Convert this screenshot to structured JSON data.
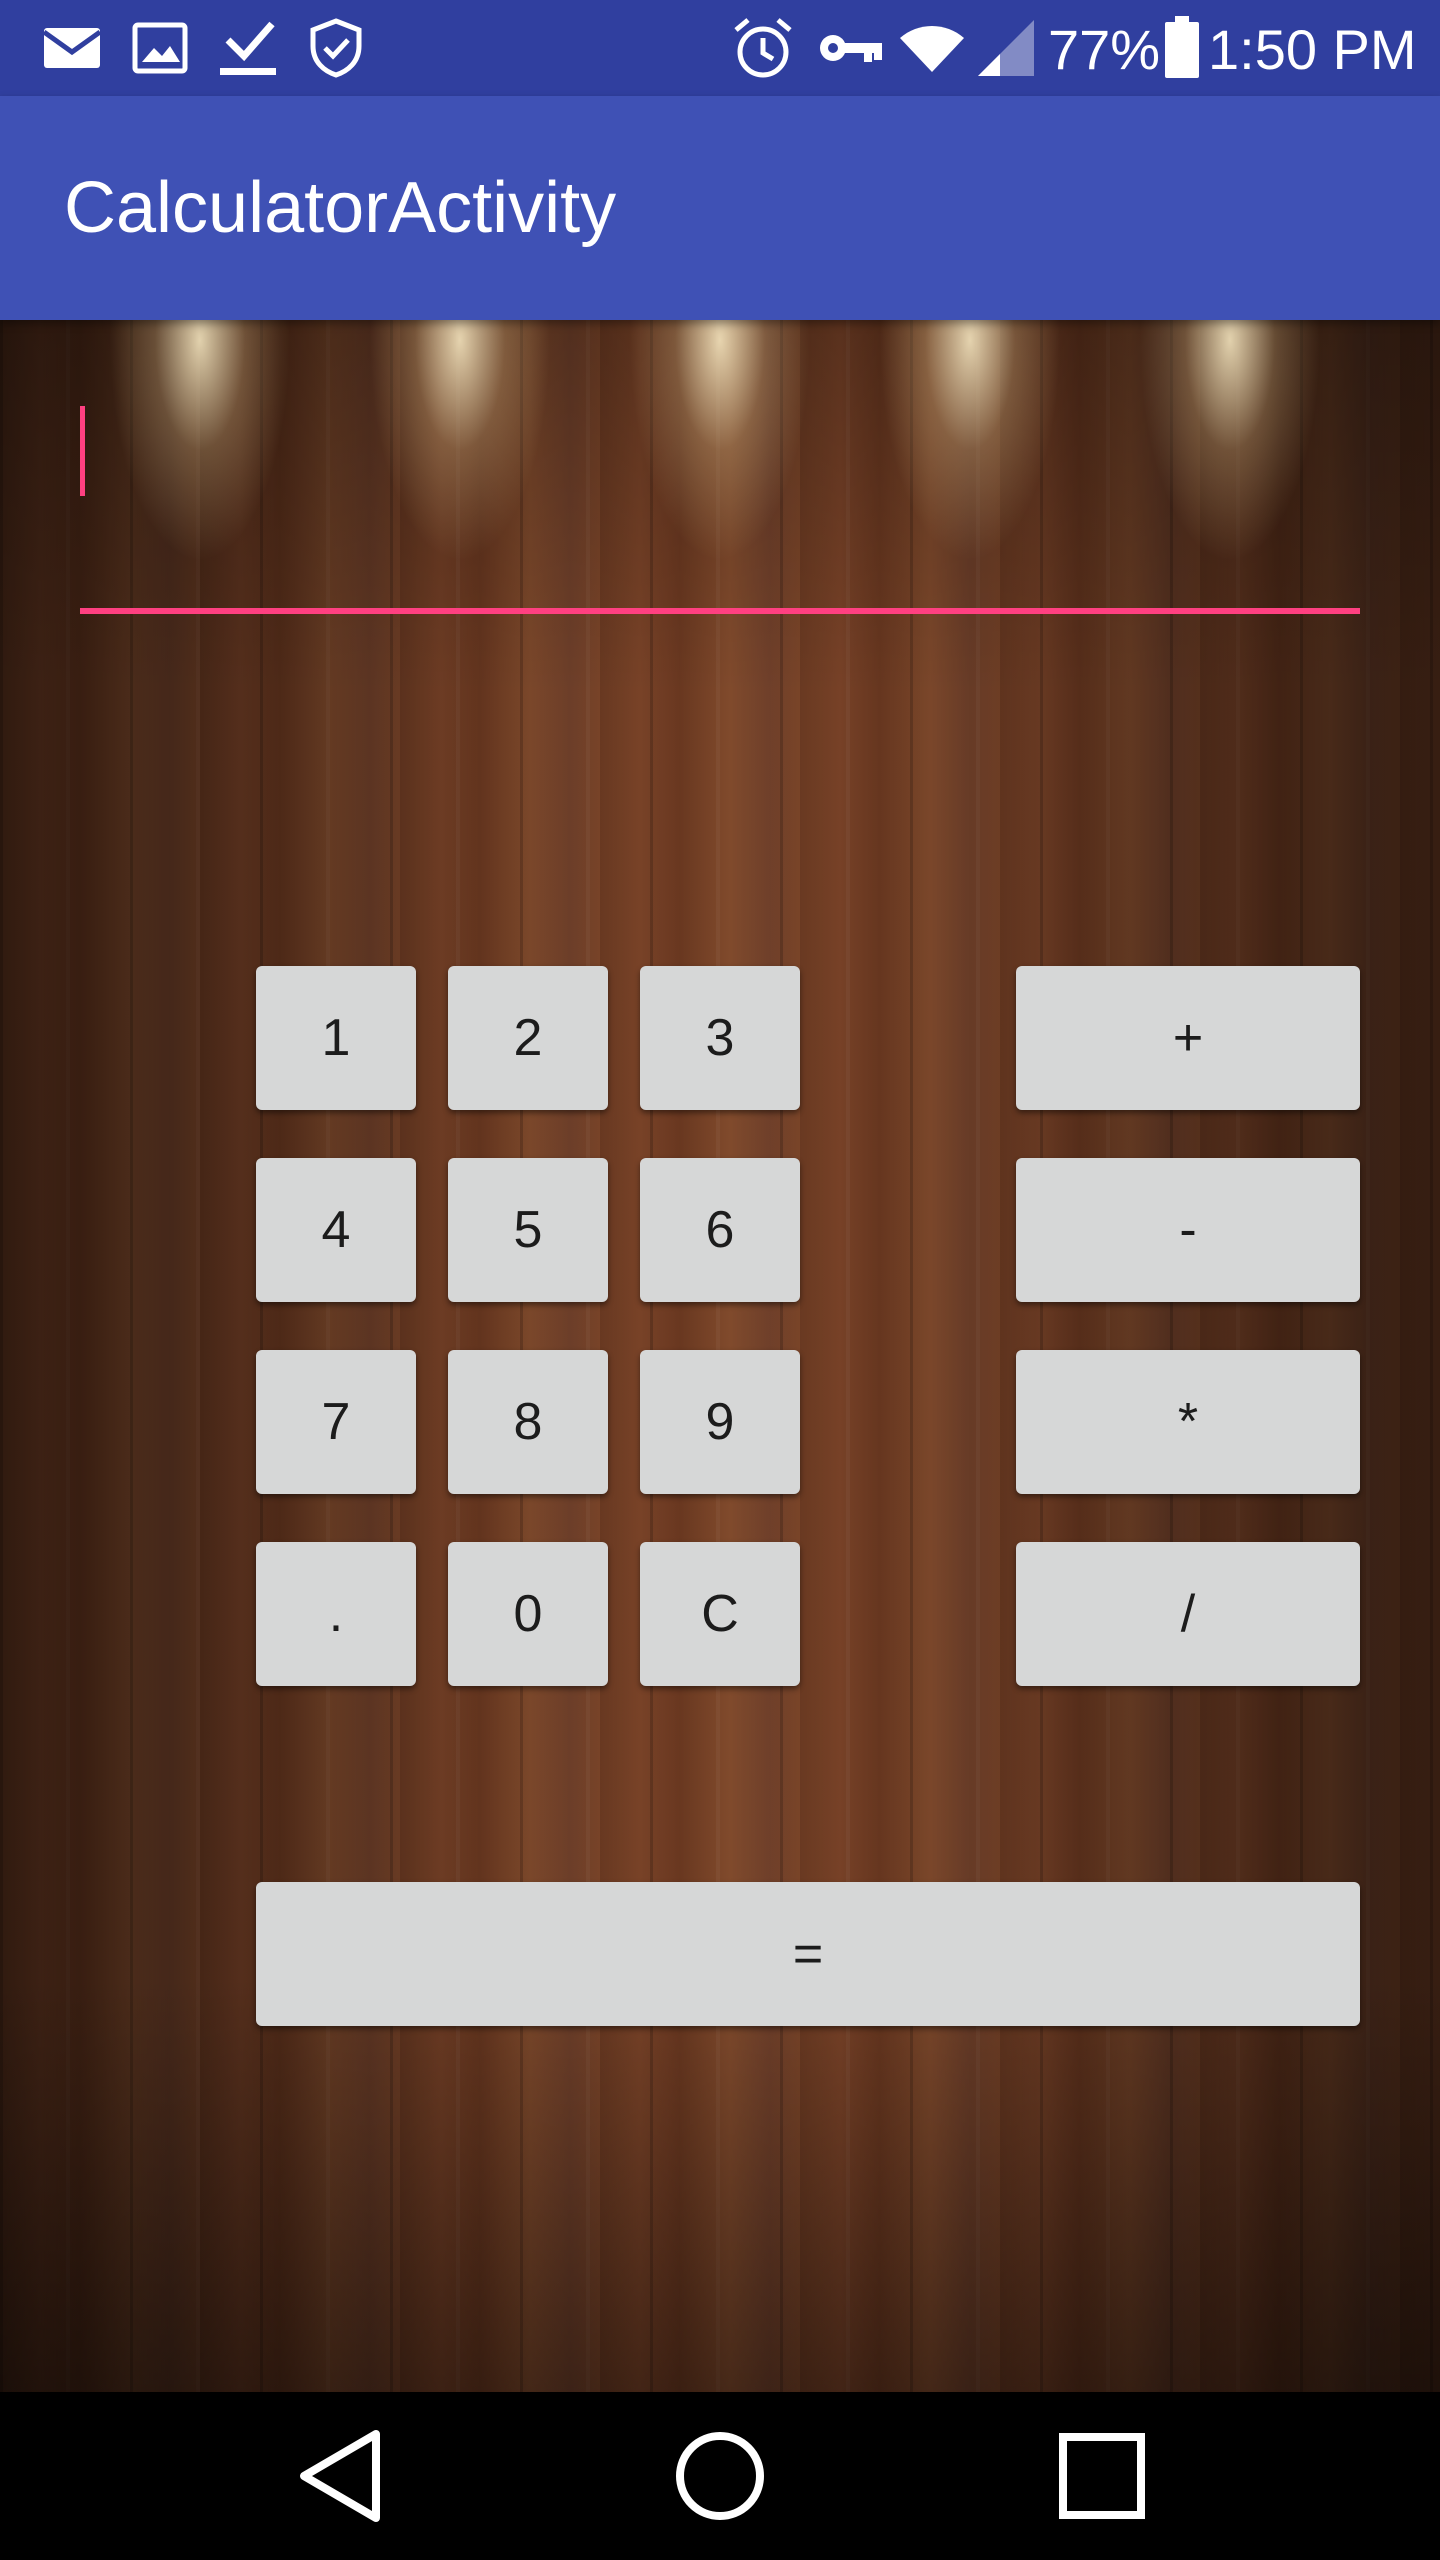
{
  "status_bar": {
    "notification_icons": [
      "mail-icon",
      "image-icon",
      "download-done-icon",
      "shield-check-icon"
    ],
    "system_icons": [
      "alarm-icon",
      "vpn-key-icon",
      "wifi-icon",
      "signal-icon",
      "battery-icon"
    ],
    "battery_percent": "77%",
    "time": "1:50 PM"
  },
  "app_bar": {
    "title": "CalculatorActivity",
    "color": "#3f51b5"
  },
  "display": {
    "value": "",
    "placeholder": "",
    "accent_color": "#ff4081"
  },
  "keypad": {
    "digits": {
      "one": "1",
      "two": "2",
      "three": "3",
      "four": "4",
      "five": "5",
      "six": "6",
      "seven": "7",
      "eight": "8",
      "nine": "9",
      "dot": ".",
      "zero": "0",
      "clear": "C"
    },
    "operators": {
      "add": "+",
      "subtract": "-",
      "multiply": "*",
      "divide": "/"
    },
    "equals": "="
  },
  "nav_bar": {
    "items": [
      "back-icon",
      "home-icon",
      "recents-icon"
    ]
  }
}
